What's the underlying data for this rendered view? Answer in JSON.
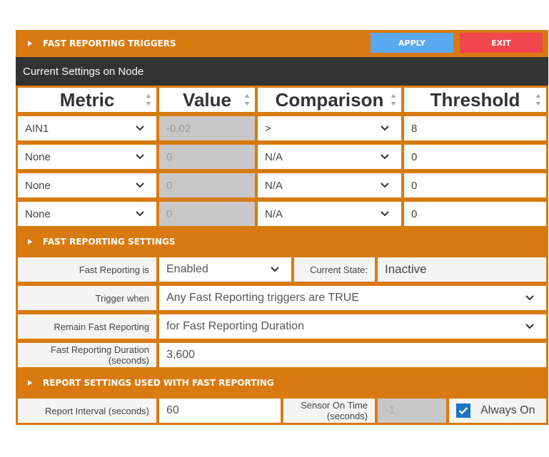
{
  "triggers_section": {
    "title": "FAST REPORTING TRIGGERS",
    "apply_label": "APPLY",
    "exit_label": "EXIT"
  },
  "current_settings_label": "Current Settings on Node",
  "columns": [
    "Metric",
    "Value",
    "Comparison",
    "Threshold"
  ],
  "trigger_rows": [
    {
      "metric": "AIN1",
      "value": "-0.02",
      "comparison": ">",
      "threshold": "8"
    },
    {
      "metric": "None",
      "value": "0",
      "comparison": "N/A",
      "threshold": "0"
    },
    {
      "metric": "None",
      "value": "0",
      "comparison": "N/A",
      "threshold": "0"
    },
    {
      "metric": "None",
      "value": "0",
      "comparison": "N/A",
      "threshold": "0"
    }
  ],
  "settings_section": {
    "title": "FAST REPORTING SETTINGS",
    "fast_reporting_label": "Fast Reporting is",
    "fast_reporting_value": "Enabled",
    "current_state_label": "Current State:",
    "current_state_value": "Inactive",
    "trigger_when_label": "Trigger when",
    "trigger_when_value": "Any Fast Reporting triggers are TRUE",
    "remain_label": "Remain Fast Reporting",
    "remain_value": "for Fast Reporting Duration",
    "duration_label_line1": "Fast Reporting Duration",
    "duration_label_line2": "(seconds)",
    "duration_value": "3,600"
  },
  "report_section": {
    "title": "REPORT SETTINGS USED WITH FAST REPORTING",
    "interval_label": "Report Interval (seconds)",
    "interval_value": "60",
    "sensor_on_label_line1": "Sensor On Time",
    "sensor_on_label_line2": "(seconds)",
    "sensor_on_value": "-1",
    "always_on_label": "Always On",
    "always_on_checked": true
  },
  "colors": {
    "accent": "#d97a10",
    "dark_bar": "#333333",
    "apply": "#5aa8f2",
    "exit": "#f0474f",
    "checkbox": "#1a73c8"
  },
  "icons": {
    "section_arrow": "caret-right-icon",
    "dropdown": "chevron-down-icon",
    "sort": "sort-icon",
    "check": "check-icon"
  }
}
